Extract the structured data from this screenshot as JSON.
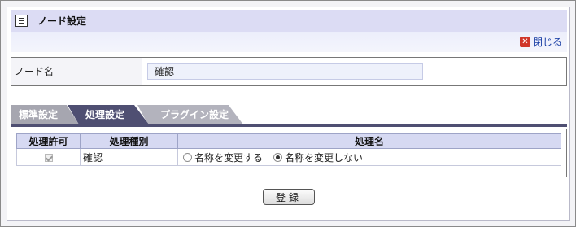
{
  "header": {
    "title": "ノード設定",
    "icon": "memo-icon"
  },
  "toolbar": {
    "close_label": "閉じる",
    "close_icon": "close-icon",
    "close_icon_color": "#d0362a"
  },
  "node_name": {
    "label": "ノード名",
    "value": "確認"
  },
  "tabs": [
    {
      "label": "標準設定",
      "active": false
    },
    {
      "label": "処理設定",
      "active": true
    },
    {
      "label": "プラグイン設定",
      "active": false
    }
  ],
  "process_table": {
    "headers": [
      "処理許可",
      "処理種別",
      "処理名"
    ],
    "rows": [
      {
        "allowed_checked": true,
        "type": "確認",
        "options": [
          {
            "label": "名称を変更する",
            "selected": false
          },
          {
            "label": "名称を変更しない",
            "selected": true
          }
        ]
      }
    ]
  },
  "actions": {
    "submit_label": "登録"
  },
  "colors": {
    "title_bar": "#dcdcf4",
    "active_tab": "#4f4f72",
    "inactive_tab": "#a6a6b0",
    "table_header": "#d6d9f2"
  }
}
